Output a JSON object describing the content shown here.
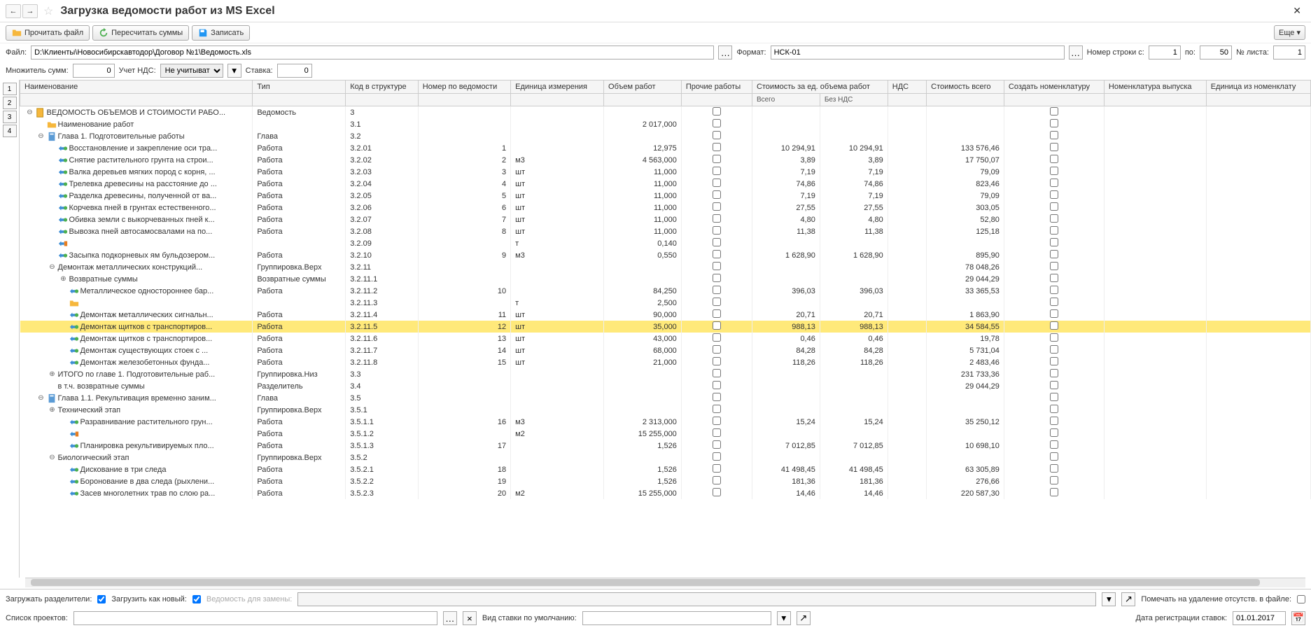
{
  "title": "Загрузка ведомости работ из MS Excel",
  "toolbar": {
    "read": "Прочитать файл",
    "recalc": "Пересчитать суммы",
    "write": "Записать",
    "more": "Еще"
  },
  "params": {
    "file_lbl": "Файл:",
    "file_val": "D:\\Клиенты\\Новосибирскавтодор\\Договор №1\\Ведомость.xls",
    "format_lbl": "Формат:",
    "format_val": "НСК-01",
    "row_from_lbl": "Номер строки с:",
    "row_from": "1",
    "row_to_lbl": "по:",
    "row_to": "50",
    "sheet_lbl": "№ листа:",
    "sheet": "1",
    "mult_lbl": "Множитель сумм:",
    "mult": "0",
    "vat_lbl": "Учет НДС:",
    "vat_val": "Не учитывать",
    "rate_lbl": "Ставка:",
    "rate": "0"
  },
  "columns": {
    "name": "Наименование",
    "type": "Тип",
    "code": "Код в структуре",
    "num": "Номер по ведомости",
    "unit": "Единица измерения",
    "vol": "Объем работ",
    "other": "Прочие работы",
    "cost_group": "Стоимость за ед. объема работ",
    "cost_total": "Всего",
    "cost_novat": "Без НДС",
    "vat": "НДС",
    "sum": "Стоимость всего",
    "create_nom": "Создать номенклатуру",
    "nom": "Номенклатура выпуска",
    "unit2": "Единица из номенклату"
  },
  "rows": [
    {
      "lvl": 0,
      "tg": "-",
      "ic": "doc",
      "name": "ВЕДОМОСТЬ ОБЪЕМОВ И СТОИМОСТИ РАБО...",
      "type": "Ведомость",
      "code": "3",
      "chk_o": true,
      "chk_c": true
    },
    {
      "lvl": 1,
      "tg": "",
      "ic": "folder",
      "name": "Наименование работ",
      "type": "",
      "code": "3.1",
      "vol": "2 017,000",
      "chk_o": true,
      "chk_c": true
    },
    {
      "lvl": 1,
      "tg": "-",
      "ic": "page",
      "name": "Глава 1. Подготовительные работы",
      "type": "Глава",
      "code": "3.2",
      "chk_o": true,
      "chk_c": true
    },
    {
      "lvl": 2,
      "tg": "",
      "ic": "work",
      "name": "Восстановление и закрепление оси тра...",
      "type": "Работа",
      "code": "3.2.01",
      "num": "1",
      "vol": "12,975",
      "ct": "10 294,91",
      "cn": "10 294,91",
      "sum": "133 576,46",
      "chk_o": true,
      "chk_c": true
    },
    {
      "lvl": 2,
      "tg": "",
      "ic": "work",
      "name": "Снятие растительного грунта на строи...",
      "type": "Работа",
      "code": "3.2.02",
      "num": "2",
      "unit": "м3",
      "vol": "4 563,000",
      "ct": "3,89",
      "cn": "3,89",
      "sum": "17 750,07",
      "chk_o": true,
      "chk_c": true
    },
    {
      "lvl": 2,
      "tg": "",
      "ic": "work",
      "name": "Валка деревьев мягких пород с корня, ...",
      "type": "Работа",
      "code": "3.2.03",
      "num": "3",
      "unit": "шт",
      "vol": "11,000",
      "ct": "7,19",
      "cn": "7,19",
      "sum": "79,09",
      "chk_o": true,
      "chk_c": true
    },
    {
      "lvl": 2,
      "tg": "",
      "ic": "work",
      "name": "Трелевка древесины на расстояние до ...",
      "type": "Работа",
      "code": "3.2.04",
      "num": "4",
      "unit": "шт",
      "vol": "11,000",
      "ct": "74,86",
      "cn": "74,86",
      "sum": "823,46",
      "chk_o": true,
      "chk_c": true
    },
    {
      "lvl": 2,
      "tg": "",
      "ic": "work",
      "name": "Разделка древесины, полученной от ва...",
      "type": "Работа",
      "code": "3.2.05",
      "num": "5",
      "unit": "шт",
      "vol": "11,000",
      "ct": "7,19",
      "cn": "7,19",
      "sum": "79,09",
      "chk_o": true,
      "chk_c": true
    },
    {
      "lvl": 2,
      "tg": "",
      "ic": "work",
      "name": "Корчевка пней в грунтах естественного...",
      "type": "Работа",
      "code": "3.2.06",
      "num": "6",
      "unit": "шт",
      "vol": "11,000",
      "ct": "27,55",
      "cn": "27,55",
      "sum": "303,05",
      "chk_o": true,
      "chk_c": true
    },
    {
      "lvl": 2,
      "tg": "",
      "ic": "work",
      "name": "Обивка земли с выкорчеванных пней к...",
      "type": "Работа",
      "code": "3.2.07",
      "num": "7",
      "unit": "шт",
      "vol": "11,000",
      "ct": "4,80",
      "cn": "4,80",
      "sum": "52,80",
      "chk_o": true,
      "chk_c": true
    },
    {
      "lvl": 2,
      "tg": "",
      "ic": "work",
      "name": "Вывозка пней автосамосвалами на по...",
      "type": "Работа",
      "code": "3.2.08",
      "num": "8",
      "unit": "шт",
      "vol": "11,000",
      "ct": "11,38",
      "cn": "11,38",
      "sum": "125,18",
      "chk_o": true,
      "chk_c": true
    },
    {
      "lvl": 2,
      "tg": "",
      "ic": "link",
      "name": "",
      "type": "",
      "code": "3.2.09",
      "unit": "т",
      "vol": "0,140",
      "chk_o": true,
      "chk_c": true
    },
    {
      "lvl": 2,
      "tg": "",
      "ic": "work",
      "name": "Засыпка подкорневых ям бульдозером...",
      "type": "Работа",
      "code": "3.2.10",
      "num": "9",
      "unit": "м3",
      "vol": "0,550",
      "ct": "1 628,90",
      "cn": "1 628,90",
      "sum": "895,90",
      "chk_o": true,
      "chk_c": true
    },
    {
      "lvl": 2,
      "tg": "-",
      "ic": "",
      "name": "Демонтаж металлических конструкций...",
      "type": "Группировка.Верх",
      "code": "3.2.11",
      "sum": "78 048,26",
      "chk_o": true,
      "chk_c": true
    },
    {
      "lvl": 3,
      "tg": "+",
      "ic": "",
      "name": "Возвратные суммы",
      "type": "Возвратные суммы",
      "code": "3.2.11.1",
      "sum": "29 044,29",
      "chk_o": true,
      "chk_c": true
    },
    {
      "lvl": 3,
      "tg": "",
      "ic": "work",
      "name": "Металлическое одностороннее бар...",
      "type": "Работа",
      "code": "3.2.11.2",
      "num": "10",
      "vol": "84,250",
      "ct": "396,03",
      "cn": "396,03",
      "sum": "33 365,53",
      "chk_o": true,
      "chk_c": true
    },
    {
      "lvl": 3,
      "tg": "",
      "ic": "folder",
      "name": "",
      "type": "",
      "code": "3.2.11.3",
      "unit": "т",
      "vol": "2,500",
      "chk_o": true,
      "chk_c": true
    },
    {
      "lvl": 3,
      "tg": "",
      "ic": "work",
      "name": "Демонтаж металлических сигнальн...",
      "type": "Работа",
      "code": "3.2.11.4",
      "num": "11",
      "unit": "шт",
      "vol": "90,000",
      "ct": "20,71",
      "cn": "20,71",
      "sum": "1 863,90",
      "chk_o": true,
      "chk_c": true
    },
    {
      "lvl": 3,
      "tg": "",
      "ic": "work",
      "name": "Демонтаж щитков с транспортиров...",
      "type": "Работа",
      "code": "3.2.11.5",
      "num": "12",
      "unit": "шт",
      "vol": "35,000",
      "ct": "988,13",
      "cn": "988,13",
      "sum": "34 584,55",
      "chk_o": true,
      "chk_c": true,
      "sel": true
    },
    {
      "lvl": 3,
      "tg": "",
      "ic": "work",
      "name": "Демонтаж щитков с транспортиров...",
      "type": "Работа",
      "code": "3.2.11.6",
      "num": "13",
      "unit": "шт",
      "vol": "43,000",
      "ct": "0,46",
      "cn": "0,46",
      "sum": "19,78",
      "chk_o": true,
      "chk_c": true
    },
    {
      "lvl": 3,
      "tg": "",
      "ic": "work",
      "name": "Демонтаж существующих стоек  с ...",
      "type": "Работа",
      "code": "3.2.11.7",
      "num": "14",
      "unit": "шт",
      "vol": "68,000",
      "ct": "84,28",
      "cn": "84,28",
      "sum": "5 731,04",
      "chk_o": true,
      "chk_c": true
    },
    {
      "lvl": 3,
      "tg": "",
      "ic": "work",
      "name": "Демонтаж железобетонных фунда...",
      "type": "Работа",
      "code": "3.2.11.8",
      "num": "15",
      "unit": "шт",
      "vol": "21,000",
      "ct": "118,26",
      "cn": "118,26",
      "sum": "2 483,46",
      "chk_o": true,
      "chk_c": true
    },
    {
      "lvl": 2,
      "tg": "+",
      "ic": "",
      "name": "ИТОГО по главе 1. Подготовительные раб...",
      "type": "Группировка.Низ",
      "code": "3.3",
      "sum": "231 733,36",
      "chk_o": true,
      "chk_c": true
    },
    {
      "lvl": 2,
      "tg": "",
      "ic": "",
      "name": "в т.ч. возвратные суммы",
      "type": "Разделитель",
      "code": "3.4",
      "sum": "29 044,29",
      "chk_o": true,
      "chk_c": true
    },
    {
      "lvl": 1,
      "tg": "-",
      "ic": "page",
      "name": "Глава 1.1. Рекультивация временно заним...",
      "type": "Глава",
      "code": "3.5",
      "chk_o": true,
      "chk_c": true
    },
    {
      "lvl": 2,
      "tg": "+",
      "ic": "",
      "name": "Технический этап",
      "type": "Группировка.Верх",
      "code": "3.5.1",
      "chk_o": true,
      "chk_c": true
    },
    {
      "lvl": 3,
      "tg": "",
      "ic": "work",
      "name": "Разравнивание растительного грун...",
      "type": "Работа",
      "code": "3.5.1.1",
      "num": "16",
      "unit": "м3",
      "vol": "2 313,000",
      "ct": "15,24",
      "cn": "15,24",
      "sum": "35 250,12",
      "chk_o": true,
      "chk_c": true
    },
    {
      "lvl": 3,
      "tg": "",
      "ic": "link",
      "name": "",
      "type": "Работа",
      "code": "3.5.1.2",
      "unit": "м2",
      "vol": "15 255,000",
      "chk_o": true,
      "chk_c": true
    },
    {
      "lvl": 3,
      "tg": "",
      "ic": "work",
      "name": "Планировка рекультивируемых пло...",
      "type": "Работа",
      "code": "3.5.1.3",
      "num": "17",
      "vol": "1,526",
      "ct": "7 012,85",
      "cn": "7 012,85",
      "sum": "10 698,10",
      "chk_o": true,
      "chk_c": true
    },
    {
      "lvl": 2,
      "tg": "-",
      "ic": "",
      "name": "Биологический этап",
      "type": "Группировка.Верх",
      "code": "3.5.2",
      "chk_o": true,
      "chk_c": true
    },
    {
      "lvl": 3,
      "tg": "",
      "ic": "work",
      "name": "Дискование в три следа",
      "type": "Работа",
      "code": "3.5.2.1",
      "num": "18",
      "vol": "1,526",
      "ct": "41 498,45",
      "cn": "41 498,45",
      "sum": "63 305,89",
      "chk_o": true,
      "chk_c": true
    },
    {
      "lvl": 3,
      "tg": "",
      "ic": "work",
      "name": "Боронование в два следа (рыхлени...",
      "type": "Работа",
      "code": "3.5.2.2",
      "num": "19",
      "vol": "1,526",
      "ct": "181,36",
      "cn": "181,36",
      "sum": "276,66",
      "chk_o": true,
      "chk_c": true
    },
    {
      "lvl": 3,
      "tg": "",
      "ic": "work",
      "name": "Засев многолетних трав по слою ра...",
      "type": "Работа",
      "code": "3.5.2.3",
      "num": "20",
      "unit": "м2",
      "vol": "15 255,000",
      "ct": "14,46",
      "cn": "14,46",
      "sum": "220 587,30",
      "chk_o": true,
      "chk_c": true
    }
  ],
  "footer": {
    "load_sep_lbl": "Загружать разделители:",
    "load_new_lbl": "Загрузить как новый:",
    "replace_lbl": "Ведомость для замены:",
    "mark_del_lbl": "Помечать на удаление отсутств. в файле:",
    "projects_lbl": "Список проектов:",
    "rate_type_lbl": "Вид ставки по умолчанию:",
    "reg_date_lbl": "Дата регистрации ставок:",
    "reg_date": "01.01.2017"
  }
}
